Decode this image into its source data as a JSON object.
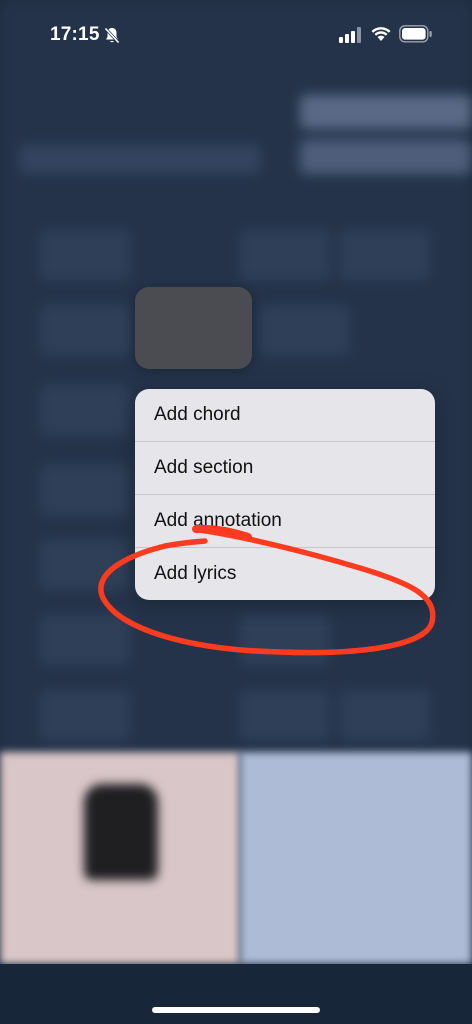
{
  "status_bar": {
    "time": "17:15"
  },
  "context_menu": {
    "items": [
      {
        "label": "Add chord"
      },
      {
        "label": "Add section"
      },
      {
        "label": "Add annotation"
      },
      {
        "label": "Add lyrics"
      }
    ]
  },
  "annotation": {
    "color": "#ff3b1f",
    "target": "Add lyrics"
  },
  "icons": [
    "bell-slash-icon",
    "cellular-signal-icon",
    "wifi-icon",
    "battery-icon"
  ]
}
